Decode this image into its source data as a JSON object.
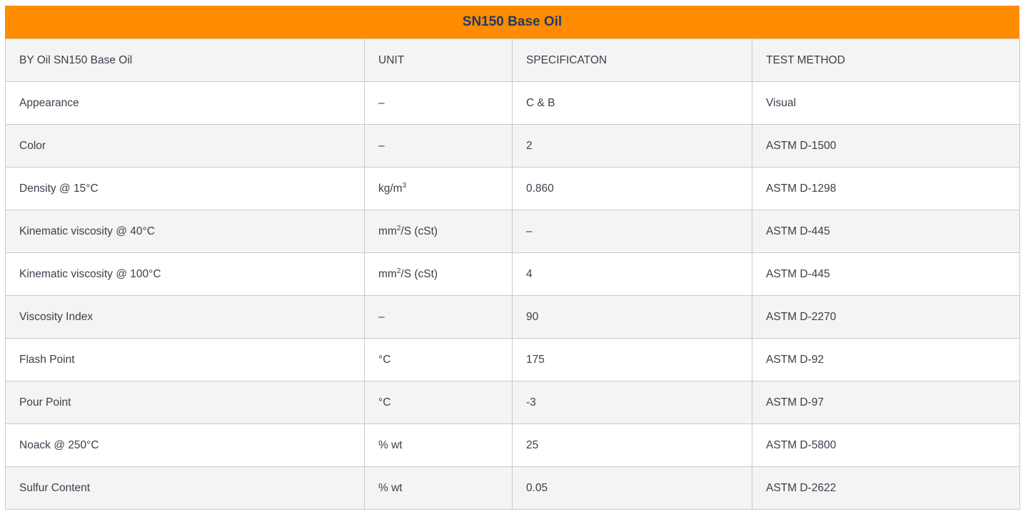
{
  "title": "SN150 Base Oil",
  "columns": [
    "BY Oil SN150 Base Oil",
    "UNIT",
    "SPECIFICATON",
    "TEST METHOD"
  ],
  "rows": [
    {
      "property": "Appearance",
      "unit": "–",
      "unit_sup": "",
      "unit_after": "",
      "spec": "C & B",
      "method": "Visual"
    },
    {
      "property": "Color",
      "unit": "–",
      "unit_sup": "",
      "unit_after": "",
      "spec": "2",
      "method": "ASTM D-1500"
    },
    {
      "property": "Density @ 15°C",
      "unit": "kg/m",
      "unit_sup": "3",
      "unit_after": "",
      "spec": "0.860",
      "method": "ASTM D-1298"
    },
    {
      "property": "Kinematic viscosity @ 40°C",
      "unit": "mm",
      "unit_sup": "2",
      "unit_after": "/S (cSt)",
      "spec": "–",
      "method": "ASTM D-445"
    },
    {
      "property": "Kinematic viscosity @ 100°C",
      "unit": "mm",
      "unit_sup": "2",
      "unit_after": "/S (cSt)",
      "spec": "4",
      "method": "ASTM D-445"
    },
    {
      "property": "Viscosity Index",
      "unit": "–",
      "unit_sup": "",
      "unit_after": "",
      "spec": "90",
      "method": "ASTM D-2270"
    },
    {
      "property": "Flash Point",
      "unit": "°C",
      "unit_sup": "",
      "unit_after": "",
      "spec": "175",
      "method": "ASTM D-92"
    },
    {
      "property": "Pour Point",
      "unit": "°C",
      "unit_sup": "",
      "unit_after": "",
      "spec": "-3",
      "method": "ASTM D-97"
    },
    {
      "property": "Noack @ 250°C",
      "unit": "% wt",
      "unit_sup": "",
      "unit_after": "",
      "spec": "25",
      "method": "ASTM D-5800"
    },
    {
      "property": "Sulfur Content",
      "unit": "% wt",
      "unit_sup": "",
      "unit_after": "",
      "spec": "0.05",
      "method": "ASTM D-2622"
    }
  ],
  "colors": {
    "title_bar": "#ff8c00",
    "title_text": "#1f3a6b",
    "row_alt": "#f4f4f4",
    "border": "#c9c9c9"
  }
}
